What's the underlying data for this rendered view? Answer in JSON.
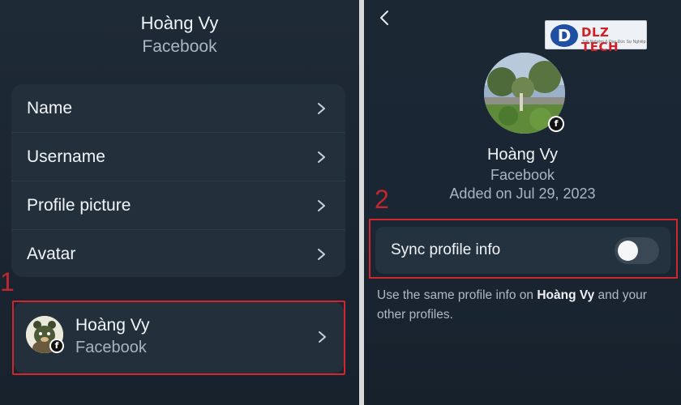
{
  "left": {
    "title": "Hoàng Vy",
    "subtitle": "Facebook",
    "menu": [
      {
        "label": "Name"
      },
      {
        "label": "Username"
      },
      {
        "label": "Profile picture"
      },
      {
        "label": "Avatar"
      }
    ],
    "step_number": "1",
    "account": {
      "name": "Hoàng Vy",
      "platform": "Facebook",
      "badge": "f"
    }
  },
  "right": {
    "watermark": {
      "mark": "D",
      "brand": "DLZ TECH",
      "tagline": "Trải Nghiệm & Đạo Đức Sự Nghiệp"
    },
    "profile": {
      "name": "Hoàng Vy",
      "platform": "Facebook",
      "added": "Added on Jul 29, 2023",
      "badge": "f"
    },
    "step_number": "2",
    "sync": {
      "label": "Sync profile info",
      "enabled": false
    },
    "description": {
      "prefix": "Use the same profile info on ",
      "bold": "Hoàng Vy",
      "suffix": " and your other profiles."
    }
  },
  "colors": {
    "accent_red": "#d0262c",
    "background": "#1b2530",
    "card": "#23303c"
  },
  "icons": [
    "chevron-right-icon",
    "back-chevron-icon",
    "facebook-icon"
  ]
}
